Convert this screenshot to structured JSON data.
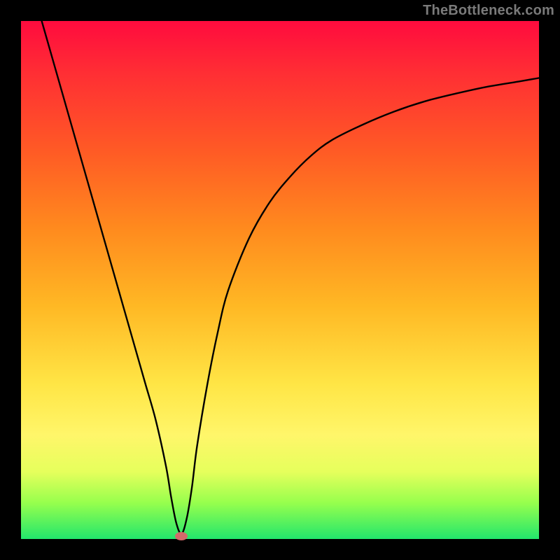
{
  "watermark": "TheBottleneck.com",
  "colors": {
    "frame": "#000000",
    "curve": "#000000",
    "marker": "#d36a6a",
    "gradient_top": "#ff0b3e",
    "gradient_bottom": "#22e66c"
  },
  "chart_data": {
    "type": "line",
    "title": "",
    "xlabel": "",
    "ylabel": "",
    "xlim": [
      0,
      100
    ],
    "ylim": [
      0,
      100
    ],
    "grid": false,
    "legend": false,
    "x": [
      4,
      6,
      8,
      10,
      12,
      14,
      16,
      18,
      20,
      22,
      24,
      26,
      28,
      29,
      30,
      31,
      32,
      33,
      34,
      36,
      38,
      40,
      44,
      48,
      52,
      56,
      60,
      66,
      72,
      78,
      84,
      90,
      96,
      100
    ],
    "values": [
      100,
      93,
      86,
      79,
      72,
      65,
      58,
      51,
      44,
      37,
      30,
      23,
      14,
      8,
      3,
      1,
      4,
      10,
      18,
      30,
      40,
      48,
      58,
      65,
      70,
      74,
      77,
      80,
      82.5,
      84.5,
      86,
      87.3,
      88.3,
      89
    ],
    "minimum_point": {
      "x": 31,
      "y": 1
    },
    "marker": {
      "x": 31,
      "y": 0.5
    }
  }
}
